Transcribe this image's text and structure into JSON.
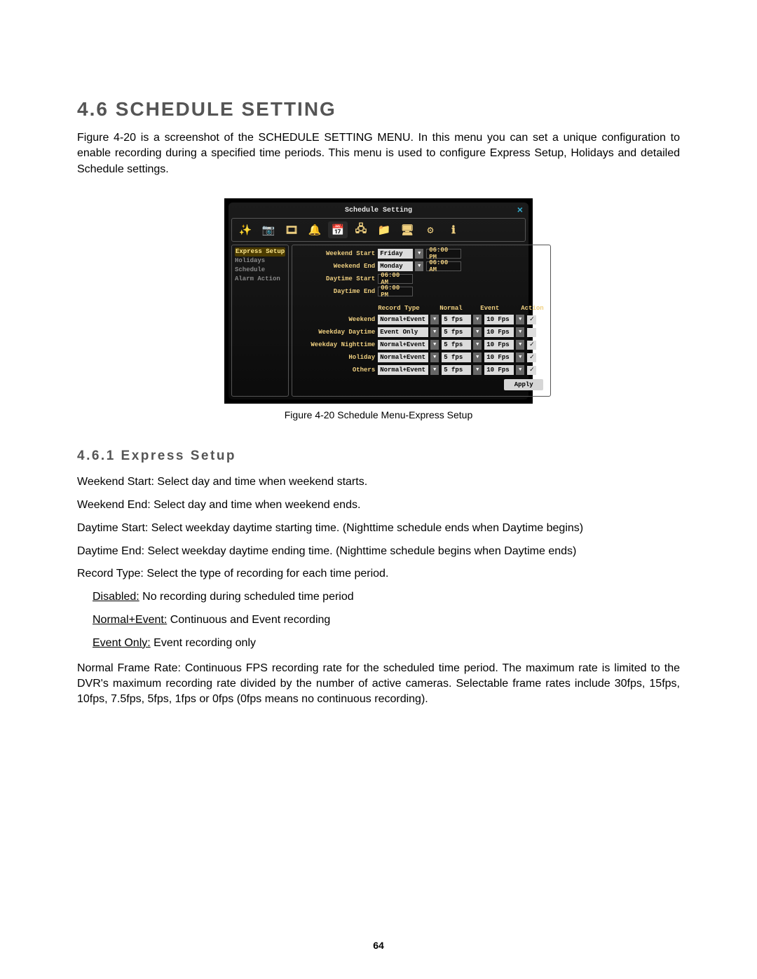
{
  "heading_main": "4.6 SCHEDULE SETTING",
  "intro_para": "Figure 4-20 is a screenshot of the SCHEDULE SETTING MENU. In this menu you can set a unique configuration to enable recording during a specified time periods.  This menu is used to configure Express Setup, Holidays and detailed Schedule settings.",
  "caption": "Figure 4-20  Schedule Menu-Express Setup",
  "heading_sub": "4.6.1   Express Setup",
  "lines": {
    "ws": "Weekend Start: Select day and time when weekend starts.",
    "we": "Weekend End: Select day and time when weekend ends.",
    "ds": "Daytime Start: Select weekday daytime starting time. (Nighttime schedule ends when Daytime begins)",
    "de": "Daytime End: Select weekday daytime ending time. (Nighttime schedule begins when Daytime ends)",
    "rt": "Record Type: Select the type of recording for each time period.",
    "disabled_u": "Disabled:",
    "disabled_t": " No recording during scheduled time period",
    "ne_u": "Normal+Event:",
    "ne_t": " Continuous and Event recording",
    "eo_u": "Event Only:",
    "eo_t": " Event recording only"
  },
  "nfr_para": "Normal Frame Rate: Continuous FPS recording rate for the scheduled time period. The maximum rate is limited to the DVR's maximum recording rate divided by the number of active cameras. Selectable frame rates include 30fps, 15fps, 10fps, 7.5fps, 5fps, 1fps or 0fps (0fps means no continuous recording).",
  "page_number": "64",
  "shot": {
    "title": "Schedule Setting",
    "toolbar_icons": [
      "✨",
      "📷",
      "🎞",
      "🔔",
      "📅",
      "🖧",
      "📁",
      "🖥",
      "⚙",
      "ℹ"
    ],
    "sidebar": [
      "Express Setup",
      "Holidays",
      "Schedule",
      "Alarm Action"
    ],
    "sidebar_selected": 0,
    "form": {
      "weekend_start_label": "Weekend Start",
      "weekend_start_day": "Friday",
      "weekend_start_time": "06:00 PM",
      "weekend_end_label": "Weekend End",
      "weekend_end_day": "Monday",
      "weekend_end_time": "06:00 AM",
      "daytime_start_label": "Daytime Start",
      "daytime_start_time": "06:00 AM",
      "daytime_end_label": "Daytime End",
      "daytime_end_time": "06:00 PM"
    },
    "headers": [
      "Record Type",
      "Normal",
      "Event",
      "Action"
    ],
    "rows": [
      {
        "label": "Weekend",
        "rec": "Normal+Event",
        "normal": "5 fps",
        "event": "10 Fps",
        "action": true
      },
      {
        "label": "Weekday Daytime",
        "rec": "Event Only",
        "normal": "5 fps",
        "event": "10 Fps",
        "action": false
      },
      {
        "label": "Weekday Nighttime",
        "rec": "Normal+Event",
        "normal": "5 fps",
        "event": "10 Fps",
        "action": true
      },
      {
        "label": "Holiday",
        "rec": "Normal+Event",
        "normal": "5 fps",
        "event": "10 Fps",
        "action": true
      },
      {
        "label": "Others",
        "rec": "Normal+Event",
        "normal": "5 fps",
        "event": "10 Fps",
        "action": true
      }
    ],
    "apply": "Apply"
  }
}
